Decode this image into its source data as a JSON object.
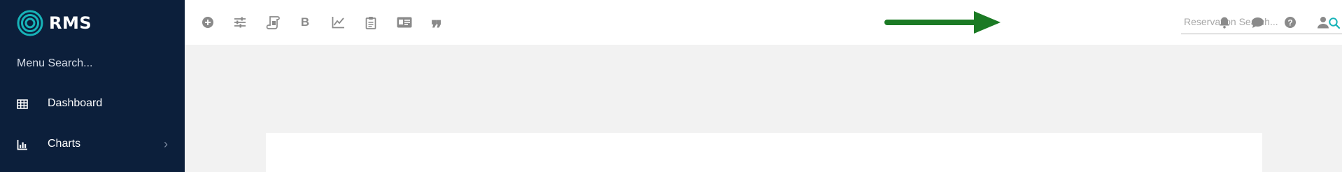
{
  "sidebar": {
    "logo_text": "RMS",
    "menu_search_text": "Menu Search...",
    "items": [
      {
        "label": "Dashboard",
        "icon": "grid-icon"
      },
      {
        "label": "Charts",
        "icon": "bar-chart-icon",
        "has_submenu": true
      }
    ]
  },
  "toolbar": {
    "icons": [
      "add-circle-icon",
      "sliders-icon",
      "scroll-icon",
      "bold-icon",
      "line-chart-icon",
      "clipboard-icon",
      "id-card-icon",
      "quote-icon"
    ],
    "bold_glyph": "B",
    "quote_glyph": "❞"
  },
  "reservation_search": {
    "placeholder": "Reservation Search..."
  },
  "header_actions": [
    "bell-icon",
    "chat-icon",
    "help-icon",
    "user-icon"
  ],
  "colors": {
    "sidebar_bg": "#0c1f3b",
    "accent": "#17b3b8",
    "icon_gray": "#8a8a8a",
    "annotation_arrow": "#1b7a24",
    "page_bg": "#f2f2f2"
  }
}
